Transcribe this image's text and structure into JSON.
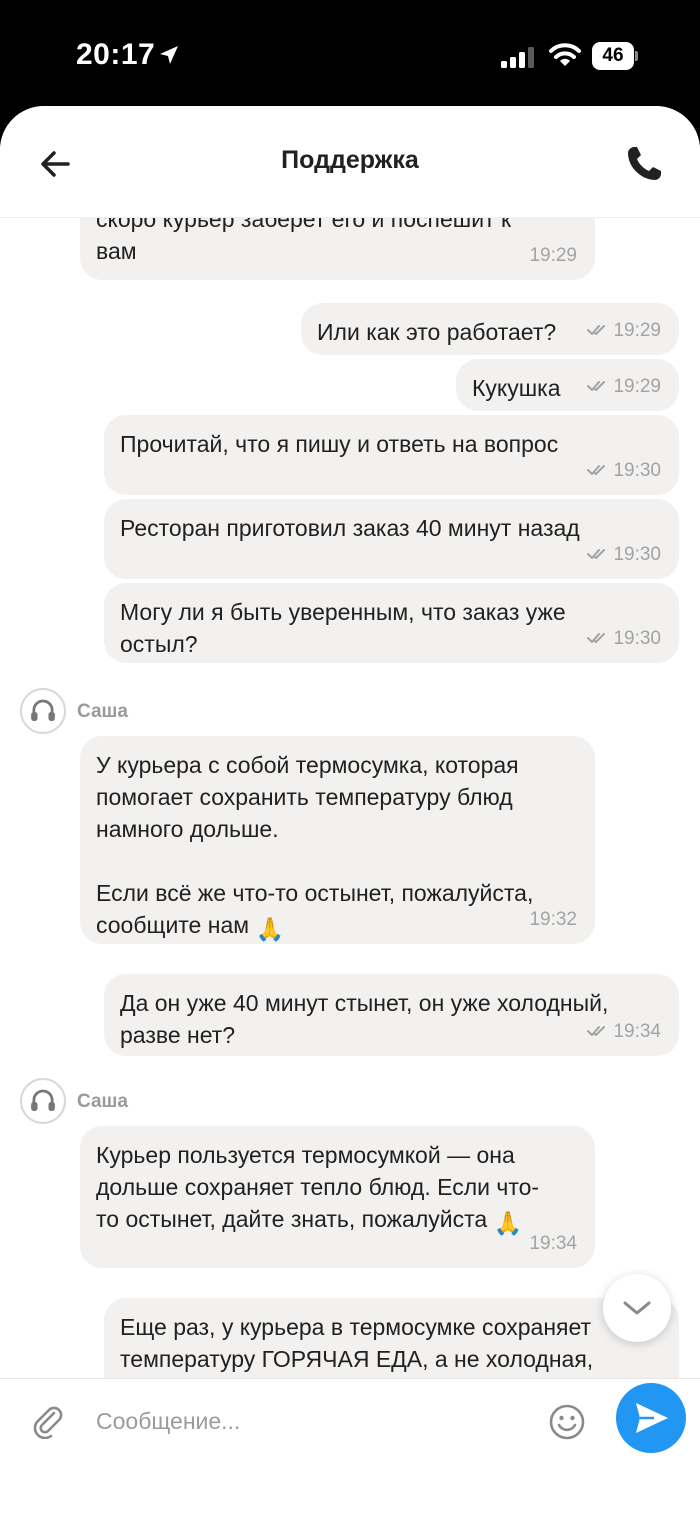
{
  "status_bar": {
    "time": "20:17",
    "battery": "46"
  },
  "header": {
    "title": "Поддержка"
  },
  "messages": [
    {
      "text": "скоро курьер заберет его и поспешит к\nвам",
      "time": "19:29"
    },
    {
      "text": "Или как это работает?",
      "time": "19:29"
    },
    {
      "text": "Кукушка",
      "time": "19:29"
    },
    {
      "text": "Прочитай, что я пишу и ответь на вопрос",
      "time": "19:30"
    },
    {
      "text": "Ресторан приготовил заказ 40 минут назад",
      "time": "19:30"
    },
    {
      "text": "Могу ли я быть уверенным, что заказ уже\nостыл?",
      "time": "19:30"
    },
    {
      "sender": "Саша",
      "text": "У курьера с собой термосумка, которая\nпомогает сохранить температуру блюд\nнамного дольше.\n\nЕсли всё же что-то остынет, пожалуйста,\nсообщите нам",
      "emoji": "🙏",
      "time": "19:32"
    },
    {
      "text": "Да он уже 40 минут стынет, он уже холодный,\nразве нет?",
      "time": "19:34"
    },
    {
      "sender": "Саша",
      "text": "Курьер пользуется термосумкой — она\nдольше сохраняет тепло блюд. Если что-\nто остынет, дайте знать, пожалуйста",
      "emoji": "🙏",
      "time": "19:34"
    },
    {
      "text": "Еще раз, у курьера в термосумке сохраняет\nтемпературу ГОРЯЧАЯ ЕДА, а не холодная,\nверно? Тепло как она сохранит тепло, если оно"
    }
  ],
  "composer": {
    "placeholder": "Сообщение..."
  },
  "icons": {
    "back": "arrow-left-icon",
    "phone": "phone-icon",
    "attach": "paperclip-icon",
    "emoji": "smiley-icon",
    "send": "send-icon",
    "scroll_down": "chevron-down-icon",
    "avatar": "headset-icon",
    "read": "double-check-icon"
  },
  "colors": {
    "bubble": "#f2f1f0",
    "send_button": "#2196f3",
    "time_text": "#a3a3a3"
  }
}
